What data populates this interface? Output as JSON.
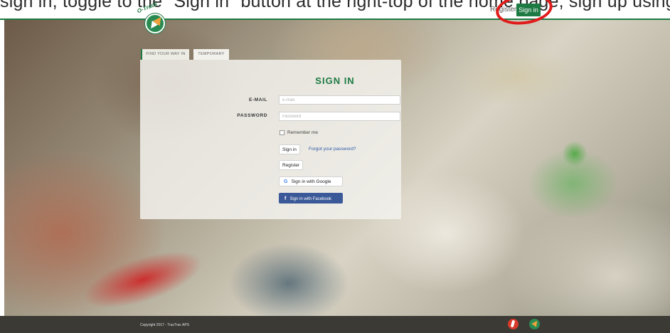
{
  "banner": {
    "text": "sign in, toggle to the \"Sign in\" button at the right-top of the home page, sign up using your G"
  },
  "header": {
    "logo_word": "O-Track",
    "register_label": "Register",
    "signin_label": "Sign in"
  },
  "tabs": [
    {
      "label": "FIND YOUR WAY IN"
    },
    {
      "label": "TEMPORARY"
    }
  ],
  "form": {
    "title": "SIGN IN",
    "email_label": "E-MAIL",
    "email_placeholder": "E-mail",
    "password_label": "PASSWORD",
    "password_placeholder": "Password",
    "remember_label": "Remember me",
    "signin_button": "Sign in",
    "forgot_link": "Forgot your password?",
    "register_button": "Register",
    "google_button": "Sign in with Google",
    "facebook_button": "Sign in with Facebook"
  },
  "footer": {
    "copyright": "Copyright 2017 - TracTrac APS"
  },
  "colors": {
    "brand_green": "#1e7a43",
    "facebook_blue": "#3b5998",
    "highlight_red": "#e01b1b",
    "footer_bg": "#3c3a35"
  }
}
